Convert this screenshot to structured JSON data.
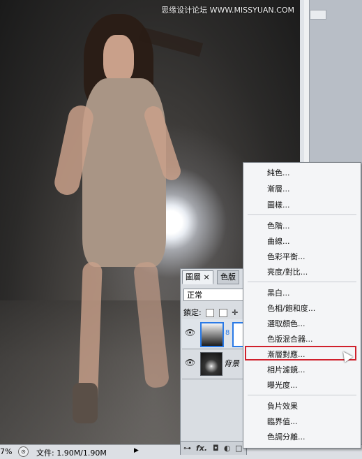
{
  "watermark": "思缘设计论坛 WWW.MISSYUAN.COM",
  "statusbar": {
    "zoom": "7%",
    "doc_info": "文件: 1.90M/1.90M",
    "arrow": "▶"
  },
  "layers_panel": {
    "tab_layers": "圖層 ×",
    "tab_channels": "色版",
    "blend_mode": "正常",
    "lock_label": "鎖定:",
    "layers": [
      {
        "name": ""
      },
      {
        "name": "背景"
      }
    ],
    "footer": {
      "link": "⊶",
      "fx": "fx.",
      "mask": "◘",
      "adj": "◐",
      "group": "□",
      "new": "⊡",
      "trash": "🗑"
    }
  },
  "adjust_menu": {
    "items": [
      "純色...",
      "漸層...",
      "圖樣...",
      "色階...",
      "曲線...",
      "色彩平衡...",
      "亮度/對比...",
      "黑白...",
      "色相/飽和度...",
      "選取顏色...",
      "色版混合器...",
      "漸層對應...",
      "相片濾鏡...",
      "曝光度...",
      "負片效果",
      "臨界值...",
      "色調分離..."
    ],
    "highlighted_index": 11
  },
  "icons": [
    "eye-icon",
    "chain-link-icon",
    "cursor-icon",
    "navigator-icon"
  ]
}
